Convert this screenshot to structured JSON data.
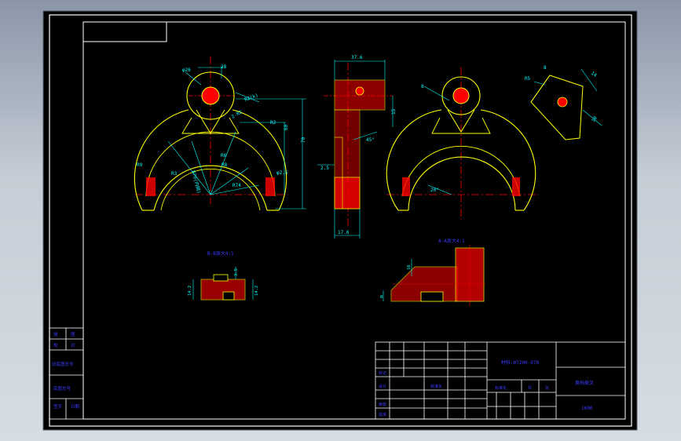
{
  "colors": {
    "background": "#000000",
    "frame": "#ffffff",
    "outline": "#ffff00",
    "section_fill": "#ff0000",
    "hatch": "#ff3030",
    "centerline": "#ff0000",
    "dimension": "#00ffff",
    "table_text": "#3a3aff",
    "chrome": "#c5cdd6"
  },
  "dimensions": {
    "front_dia_top": "φ26",
    "front_width_top": "28",
    "front_radius_a": "R2(k)",
    "front_2r": "2-R2",
    "front_h1": "60",
    "front_h2": "70",
    "front_r3": "R3",
    "front_r2": "R2",
    "front_r9": "R9",
    "front_r8": "R8",
    "front_arc": "R70(内侧)",
    "front_r74": "R74",
    "front_r6": "R6",
    "front_dia2": "φ2.5",
    "side_top": "37.6",
    "side_15": "15",
    "side_45": "45°",
    "side_25": "2.5",
    "side_bottom": "17.6",
    "right_8": "8",
    "right_20": "20°",
    "iso_r5": "R5",
    "iso_8": "8",
    "iso_14": "14",
    "iso_10": "10"
  },
  "section_labels": {
    "bb": "B-B放大4:1",
    "aa": "A-A放大4:1"
  },
  "bb_dims": {
    "a": "14.2",
    "b": "3.5",
    "c": "14.2"
  },
  "aa_dims": {
    "a": "16",
    "b": "8"
  },
  "left_table": {
    "rows": [
      [
        "描",
        "图"
      ],
      [
        "校",
        "对"
      ],
      [
        "旧底图总号"
      ],
      [
        "底图总号"
      ],
      [
        "签字",
        "日期"
      ]
    ]
  },
  "title_block": {
    "material_label": "材料:HT200-070",
    "part_name": "换挡拨叉",
    "drawing_number": "1600",
    "scale_label": "标准化",
    "sheet_label": "共",
    "sheet_label2": "张",
    "design_label": "设计",
    "check_label": "审核",
    "approve_label": "批准",
    "count_label": "标记"
  }
}
